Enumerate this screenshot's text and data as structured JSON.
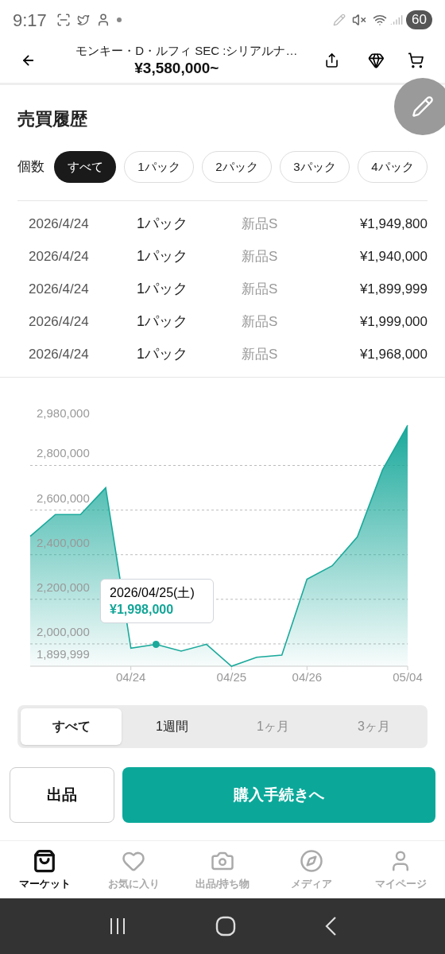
{
  "status_bar": {
    "time": "9:17",
    "battery": "60"
  },
  "header": {
    "title": "モンキー・D・ルフィ SEC :シリアルナ…",
    "price": "¥3,580,000~"
  },
  "history": {
    "title": "売買履歴",
    "filter_label": "個数",
    "filters": [
      {
        "label": "すべて",
        "selected": true
      },
      {
        "label": "1パック",
        "selected": false
      },
      {
        "label": "2パック",
        "selected": false
      },
      {
        "label": "3パック",
        "selected": false
      },
      {
        "label": "4パック",
        "selected": false
      }
    ],
    "rows": [
      {
        "date": "2026/4/24",
        "quantity": "1パック",
        "condition": "新品S",
        "price": "¥1,949,800"
      },
      {
        "date": "2026/4/24",
        "quantity": "1パック",
        "condition": "新品S",
        "price": "¥1,940,000"
      },
      {
        "date": "2026/4/24",
        "quantity": "1パック",
        "condition": "新品S",
        "price": "¥1,899,999"
      },
      {
        "date": "2026/4/24",
        "quantity": "1パック",
        "condition": "新品S",
        "price": "¥1,999,000"
      },
      {
        "date": "2026/4/24",
        "quantity": "1パック",
        "condition": "新品S",
        "price": "¥1,968,000"
      }
    ]
  },
  "chart": {
    "chart_data": {
      "type": "area",
      "grid": true,
      "categories": [
        null,
        null,
        null,
        null,
        "04/24",
        null,
        null,
        null,
        "04/25",
        null,
        null,
        "04/26",
        null,
        null,
        null,
        "05/04"
      ],
      "series": [
        {
          "color": "#1aa99b",
          "values": [
            2482000,
            2580000,
            2580000,
            2700000,
            1981000,
            1998000,
            1968000,
            1998000,
            1900000,
            1940000,
            1950000,
            2290000,
            2350000,
            2480000,
            2780000,
            2980000
          ]
        }
      ],
      "ylim": [
        1899999,
        2980000
      ],
      "yticks": [
        {
          "value": 1899999,
          "label": "1,899,999"
        },
        {
          "value": 2000000,
          "label": "2,000,000"
        },
        {
          "value": 2200000,
          "label": "2,200,000"
        },
        {
          "value": 2400000,
          "label": "2,400,000"
        },
        {
          "value": 2600000,
          "label": "2,600,000"
        },
        {
          "value": 2800000,
          "label": "2,800,000"
        },
        {
          "value": 2980000,
          "label": "2,980,000"
        }
      ]
    },
    "tooltip": {
      "date": "2026/04/25(土)",
      "price": "¥1,998,000"
    }
  },
  "ranges": [
    {
      "label": "すべて",
      "selected": true,
      "disabled": false
    },
    {
      "label": "1週間",
      "selected": false,
      "disabled": false
    },
    {
      "label": "1ヶ月",
      "selected": false,
      "disabled": true
    },
    {
      "label": "3ヶ月",
      "selected": false,
      "disabled": true
    }
  ],
  "actions": {
    "sell": "出品",
    "buy": "購入手続きへ"
  },
  "nav": [
    {
      "label": "マーケット",
      "selected": true
    },
    {
      "label": "お気に入り",
      "selected": false
    },
    {
      "label": "出品/持ち物",
      "selected": false
    },
    {
      "label": "メディア",
      "selected": false
    },
    {
      "label": "マイページ",
      "selected": false
    }
  ]
}
